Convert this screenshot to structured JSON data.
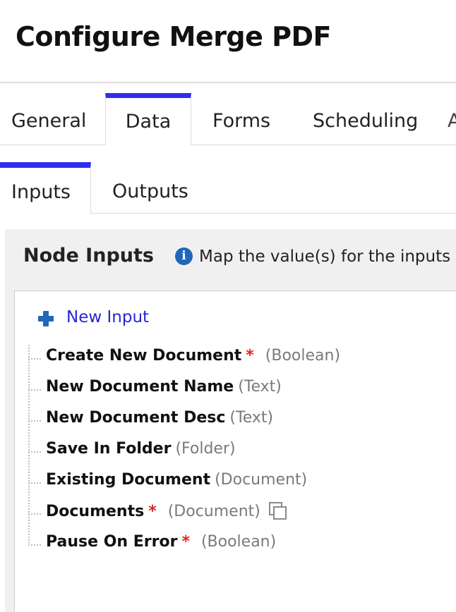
{
  "page": {
    "title": "Configure Merge PDF"
  },
  "tabs": [
    {
      "label": "General",
      "active": false
    },
    {
      "label": "Data",
      "active": true
    },
    {
      "label": "Forms",
      "active": false
    },
    {
      "label": "Scheduling",
      "active": false
    },
    {
      "label": "A",
      "active": false
    }
  ],
  "subtabs": [
    {
      "label": "Inputs",
      "active": true
    },
    {
      "label": "Outputs",
      "active": false
    }
  ],
  "panel": {
    "title": "Node Inputs",
    "info_icon": "info-icon",
    "info_text": "Map the value(s) for the inputs of"
  },
  "new_input": {
    "label": "New Input",
    "icon": "plus-icon"
  },
  "inputs": [
    {
      "name": "Create New Document",
      "required": true,
      "type": "(Boolean)"
    },
    {
      "name": "New Document Name",
      "required": false,
      "type": "(Text)"
    },
    {
      "name": "New Document Desc",
      "required": false,
      "type": "(Text)"
    },
    {
      "name": "Save In Folder",
      "required": false,
      "type": "(Folder)"
    },
    {
      "name": "Existing Document",
      "required": false,
      "type": "(Document)"
    },
    {
      "name": "Documents",
      "required": true,
      "type": "(Document)",
      "icon": "copy-icon"
    },
    {
      "name": "Pause On Error",
      "required": true,
      "type": "(Boolean)"
    }
  ],
  "required_marker": "*",
  "colors": {
    "accent": "#2f2ef0",
    "link": "#2626d9",
    "required": "#e8231e",
    "info": "#2167b9"
  }
}
